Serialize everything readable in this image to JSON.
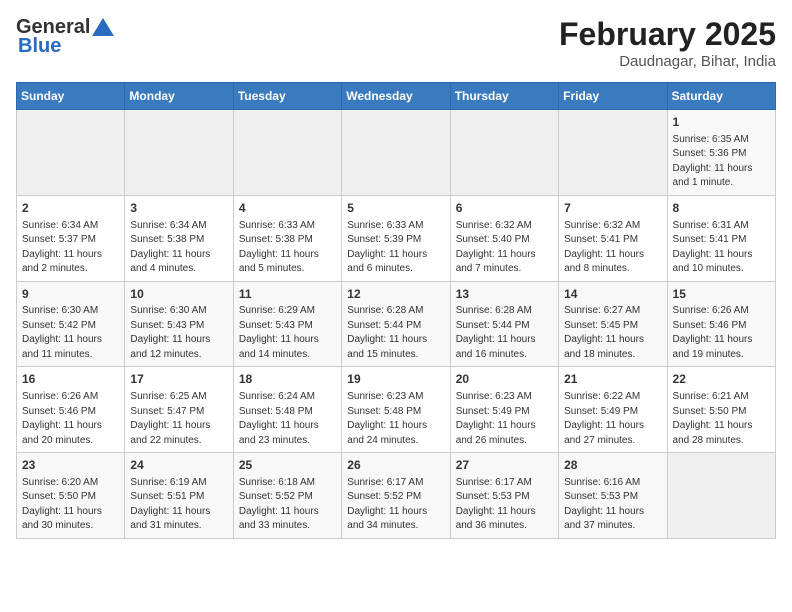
{
  "header": {
    "logo_general": "General",
    "logo_blue": "Blue",
    "title": "February 2025",
    "subtitle": "Daudnagar, Bihar, India"
  },
  "days_of_week": [
    "Sunday",
    "Monday",
    "Tuesday",
    "Wednesday",
    "Thursday",
    "Friday",
    "Saturday"
  ],
  "weeks": [
    [
      {
        "day": "",
        "info": ""
      },
      {
        "day": "",
        "info": ""
      },
      {
        "day": "",
        "info": ""
      },
      {
        "day": "",
        "info": ""
      },
      {
        "day": "",
        "info": ""
      },
      {
        "day": "",
        "info": ""
      },
      {
        "day": "1",
        "info": "Sunrise: 6:35 AM\nSunset: 5:36 PM\nDaylight: 11 hours and 1 minute."
      }
    ],
    [
      {
        "day": "2",
        "info": "Sunrise: 6:34 AM\nSunset: 5:37 PM\nDaylight: 11 hours and 2 minutes."
      },
      {
        "day": "3",
        "info": "Sunrise: 6:34 AM\nSunset: 5:38 PM\nDaylight: 11 hours and 4 minutes."
      },
      {
        "day": "4",
        "info": "Sunrise: 6:33 AM\nSunset: 5:38 PM\nDaylight: 11 hours and 5 minutes."
      },
      {
        "day": "5",
        "info": "Sunrise: 6:33 AM\nSunset: 5:39 PM\nDaylight: 11 hours and 6 minutes."
      },
      {
        "day": "6",
        "info": "Sunrise: 6:32 AM\nSunset: 5:40 PM\nDaylight: 11 hours and 7 minutes."
      },
      {
        "day": "7",
        "info": "Sunrise: 6:32 AM\nSunset: 5:41 PM\nDaylight: 11 hours and 8 minutes."
      },
      {
        "day": "8",
        "info": "Sunrise: 6:31 AM\nSunset: 5:41 PM\nDaylight: 11 hours and 10 minutes."
      }
    ],
    [
      {
        "day": "9",
        "info": "Sunrise: 6:30 AM\nSunset: 5:42 PM\nDaylight: 11 hours and 11 minutes."
      },
      {
        "day": "10",
        "info": "Sunrise: 6:30 AM\nSunset: 5:43 PM\nDaylight: 11 hours and 12 minutes."
      },
      {
        "day": "11",
        "info": "Sunrise: 6:29 AM\nSunset: 5:43 PM\nDaylight: 11 hours and 14 minutes."
      },
      {
        "day": "12",
        "info": "Sunrise: 6:28 AM\nSunset: 5:44 PM\nDaylight: 11 hours and 15 minutes."
      },
      {
        "day": "13",
        "info": "Sunrise: 6:28 AM\nSunset: 5:44 PM\nDaylight: 11 hours and 16 minutes."
      },
      {
        "day": "14",
        "info": "Sunrise: 6:27 AM\nSunset: 5:45 PM\nDaylight: 11 hours and 18 minutes."
      },
      {
        "day": "15",
        "info": "Sunrise: 6:26 AM\nSunset: 5:46 PM\nDaylight: 11 hours and 19 minutes."
      }
    ],
    [
      {
        "day": "16",
        "info": "Sunrise: 6:26 AM\nSunset: 5:46 PM\nDaylight: 11 hours and 20 minutes."
      },
      {
        "day": "17",
        "info": "Sunrise: 6:25 AM\nSunset: 5:47 PM\nDaylight: 11 hours and 22 minutes."
      },
      {
        "day": "18",
        "info": "Sunrise: 6:24 AM\nSunset: 5:48 PM\nDaylight: 11 hours and 23 minutes."
      },
      {
        "day": "19",
        "info": "Sunrise: 6:23 AM\nSunset: 5:48 PM\nDaylight: 11 hours and 24 minutes."
      },
      {
        "day": "20",
        "info": "Sunrise: 6:23 AM\nSunset: 5:49 PM\nDaylight: 11 hours and 26 minutes."
      },
      {
        "day": "21",
        "info": "Sunrise: 6:22 AM\nSunset: 5:49 PM\nDaylight: 11 hours and 27 minutes."
      },
      {
        "day": "22",
        "info": "Sunrise: 6:21 AM\nSunset: 5:50 PM\nDaylight: 11 hours and 28 minutes."
      }
    ],
    [
      {
        "day": "23",
        "info": "Sunrise: 6:20 AM\nSunset: 5:50 PM\nDaylight: 11 hours and 30 minutes."
      },
      {
        "day": "24",
        "info": "Sunrise: 6:19 AM\nSunset: 5:51 PM\nDaylight: 11 hours and 31 minutes."
      },
      {
        "day": "25",
        "info": "Sunrise: 6:18 AM\nSunset: 5:52 PM\nDaylight: 11 hours and 33 minutes."
      },
      {
        "day": "26",
        "info": "Sunrise: 6:17 AM\nSunset: 5:52 PM\nDaylight: 11 hours and 34 minutes."
      },
      {
        "day": "27",
        "info": "Sunrise: 6:17 AM\nSunset: 5:53 PM\nDaylight: 11 hours and 36 minutes."
      },
      {
        "day": "28",
        "info": "Sunrise: 6:16 AM\nSunset: 5:53 PM\nDaylight: 11 hours and 37 minutes."
      },
      {
        "day": "",
        "info": ""
      }
    ]
  ]
}
